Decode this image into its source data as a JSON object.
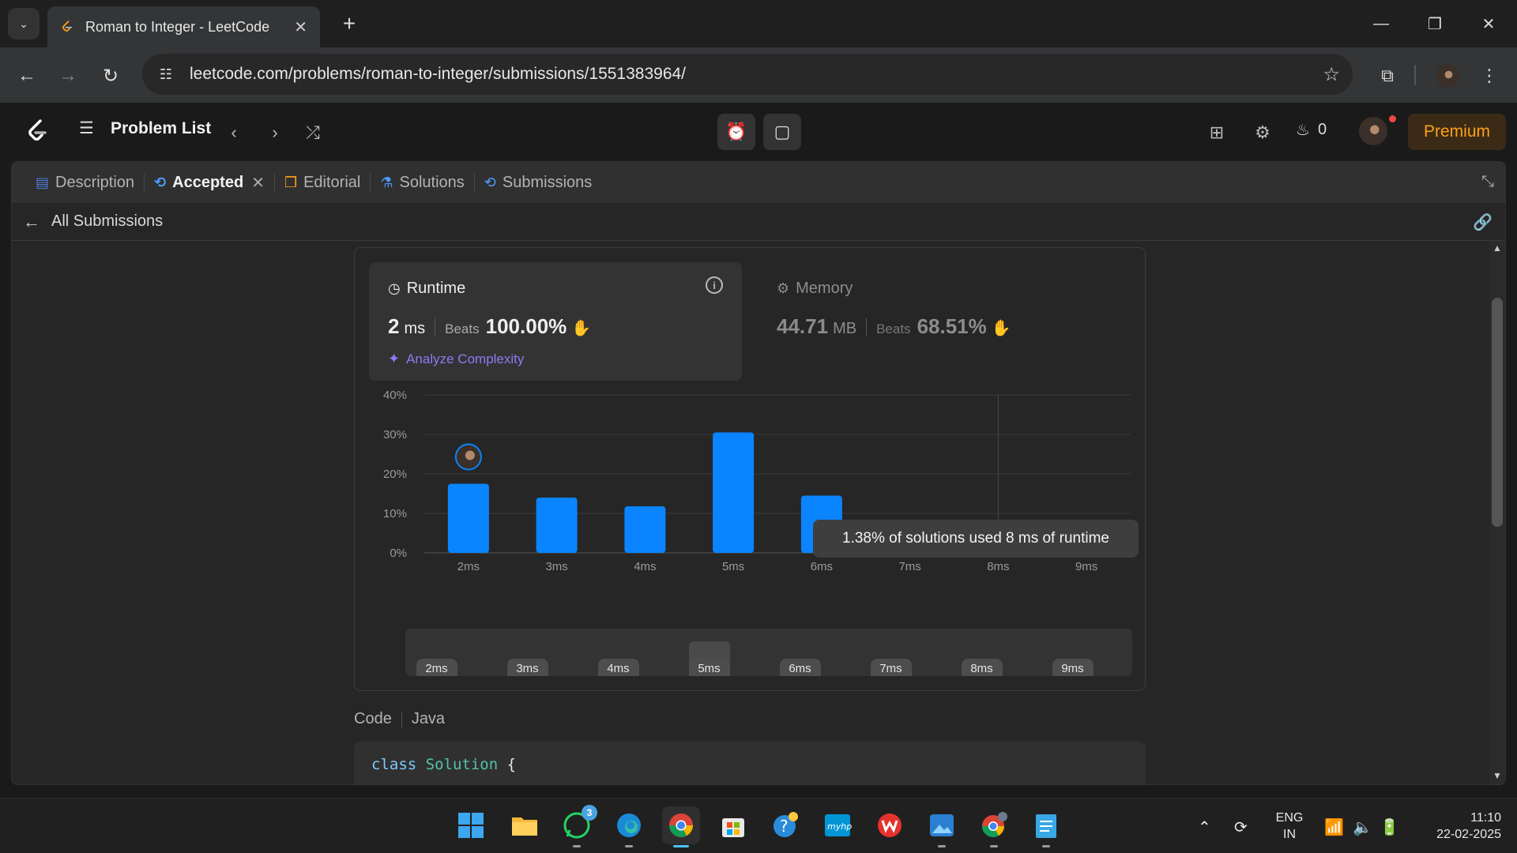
{
  "browser": {
    "tab_title": "Roman to Integer - LeetCode",
    "url": "leetcode.com/problems/roman-to-integer/submissions/1551383964/"
  },
  "header": {
    "problem_list": "Problem List",
    "streak_count": "0",
    "premium": "Premium"
  },
  "panel": {
    "tabs": [
      {
        "label": "Description"
      },
      {
        "label": "Accepted"
      },
      {
        "label": "Editorial"
      },
      {
        "label": "Solutions"
      },
      {
        "label": "Submissions"
      }
    ],
    "back_label": "All Submissions"
  },
  "runtime": {
    "title": "Runtime",
    "value": "2",
    "unit": "ms",
    "beats_label": "Beats",
    "beats": "100.00%",
    "analyze": "Analyze Complexity"
  },
  "memory": {
    "title": "Memory",
    "value": "44.71",
    "unit": "MB",
    "beats_label": "Beats",
    "beats": "68.51%"
  },
  "chart_data": {
    "type": "bar",
    "categories": [
      "2ms",
      "3ms",
      "4ms",
      "5ms",
      "6ms",
      "7ms",
      "8ms",
      "9ms"
    ],
    "values": [
      17.5,
      14,
      11.8,
      30.5,
      14.5,
      3.5,
      1.38,
      1.2
    ],
    "y_ticks": [
      "0%",
      "10%",
      "20%",
      "30%",
      "40%"
    ],
    "ylim": [
      0,
      40
    ],
    "highlight_category": "2ms",
    "tooltip": "1.38% of solutions used 8 ms of runtime",
    "bar_color": "#0a84ff",
    "grid": true
  },
  "range": {
    "labels": [
      "2ms",
      "3ms",
      "4ms",
      "5ms",
      "6ms",
      "7ms",
      "8ms",
      "9ms"
    ],
    "selected": "5ms"
  },
  "code": {
    "label": "Code",
    "language": "Java",
    "keyword": "class",
    "class_name": "Solution",
    "brace": "{"
  },
  "taskbar": {
    "whatsapp_badge": "3",
    "lang_top": "ENG",
    "lang_bottom": "IN",
    "time": "11:10",
    "date": "22-02-2025"
  }
}
